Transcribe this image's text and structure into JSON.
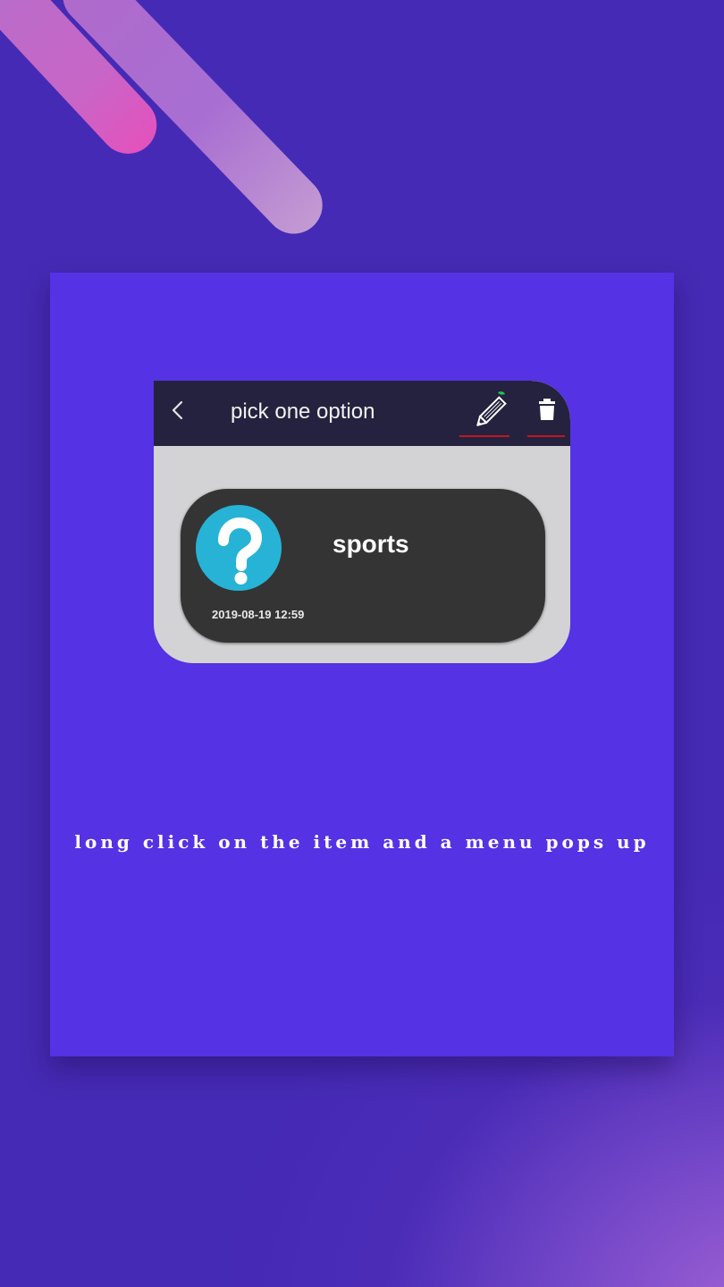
{
  "decorations": [
    {
      "name": "pink-stripe",
      "colors": [
        "#b070cc",
        "#e352bd"
      ]
    },
    {
      "name": "lilac-stripe",
      "colors": [
        "#b06acb",
        "#c39ad2"
      ]
    }
  ],
  "phone": {
    "toolbar": {
      "back_icon": "chevron-left-icon",
      "title": "pick one option",
      "actions": [
        {
          "name": "edit",
          "icon": "pencil-icon"
        },
        {
          "name": "delete",
          "icon": "trash-icon"
        }
      ],
      "underline_color": "#c0171f"
    },
    "item": {
      "icon": "question-mark-icon",
      "title": "sports",
      "date": "2019-08-19 12:59"
    }
  },
  "caption": "long click on the item and a menu pops up",
  "colors": {
    "background": "#452ab5",
    "panel": "#5532e3",
    "toolbar": "#25223f",
    "card": "#343434",
    "avatar": "#27b3d6",
    "phone_body": "#d3d3d5"
  }
}
